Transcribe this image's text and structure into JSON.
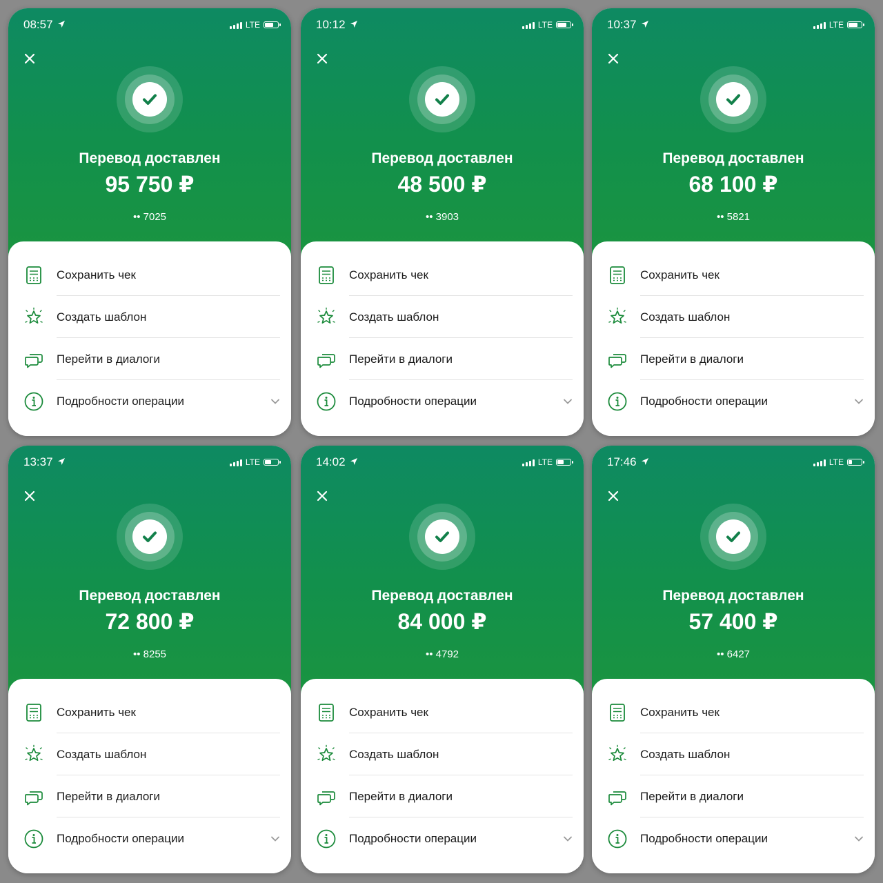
{
  "theme": {
    "primary": "#12904c",
    "accent": "#1a8a3a",
    "background": "#8a8a8a"
  },
  "icons": {
    "close": "close-icon",
    "success": "checkmark-icon",
    "receipt": "receipt-icon",
    "template": "star-icon",
    "dialogs": "chat-bubbles-icon",
    "details": "info-icon",
    "expand": "chevron-down-icon",
    "location": "location-arrow-icon",
    "signal": "signal-icon",
    "battery": "battery-icon"
  },
  "screens": [
    {
      "time": "08:57",
      "network": "LTE",
      "battery_level": 0.7,
      "title": "Перевод доставлен",
      "amount": "95 750 ₽",
      "card": "•• 7025",
      "actions": [
        "Сохранить чек",
        "Создать шаблон",
        "Перейти в диалоги",
        "Подробности операции"
      ]
    },
    {
      "time": "10:12",
      "network": "LTE",
      "battery_level": 0.75,
      "title": "Перевод доставлен",
      "amount": "48 500 ₽",
      "card": "•• 3903",
      "actions": [
        "Сохранить чек",
        "Создать шаблон",
        "Перейти в диалоги",
        "Подробности операции"
      ]
    },
    {
      "time": "10:37",
      "network": "LTE",
      "battery_level": 0.75,
      "title": "Перевод доставлен",
      "amount": "68 100 ₽",
      "card": "•• 5821",
      "actions": [
        "Сохранить чек",
        "Создать шаблон",
        "Перейти в диалоги",
        "Подробности операции"
      ]
    },
    {
      "time": "13:37",
      "network": "LTE",
      "battery_level": 0.55,
      "title": "Перевод доставлен",
      "amount": "72 800 ₽",
      "card": "•• 8255",
      "actions": [
        "Сохранить чек",
        "Создать шаблон",
        "Перейти в диалоги",
        "Подробности операции"
      ]
    },
    {
      "time": "14:02",
      "network": "LTE",
      "battery_level": 0.5,
      "title": "Перевод доставлен",
      "amount": "84 000 ₽",
      "card": "•• 4792",
      "actions": [
        "Сохранить чек",
        "Создать шаблон",
        "Перейти в диалоги",
        "Подробности операции"
      ]
    },
    {
      "time": "17:46",
      "network": "LTE",
      "battery_level": 0.3,
      "title": "Перевод доставлен",
      "amount": "57 400 ₽",
      "card": "•• 6427",
      "actions": [
        "Сохранить чек",
        "Создать шаблон",
        "Перейти в диалоги",
        "Подробности операции"
      ]
    }
  ]
}
